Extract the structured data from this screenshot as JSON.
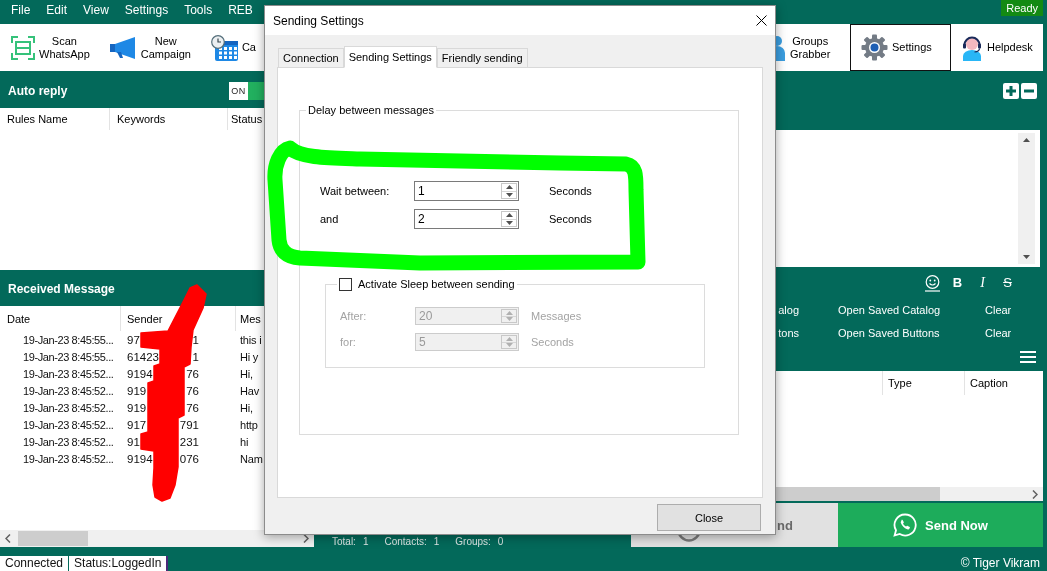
{
  "menu": {
    "items": [
      "File",
      "Edit",
      "View",
      "Settings",
      "Tools",
      "REB"
    ],
    "badge": "Ready"
  },
  "toolbar": {
    "left": [
      {
        "lines": [
          "Scan",
          "WhatsApp"
        ],
        "selected": false
      },
      {
        "lines": [
          "New",
          "Campaign"
        ],
        "selected": false
      },
      {
        "lines": [
          "Ca"
        ],
        "selected": false
      }
    ],
    "right": [
      {
        "lines": [
          "Groups",
          "Grabber"
        ],
        "selected": false
      },
      {
        "lines": [
          "Settings"
        ],
        "selected": true
      },
      {
        "lines": [
          "Helpdesk"
        ],
        "selected": false
      }
    ]
  },
  "auto_reply": {
    "title": "Auto reply",
    "toggle": {
      "label": "ON",
      "on": true
    },
    "columns": [
      "Rules Name",
      "Keywords",
      "Status"
    ]
  },
  "received": {
    "title": "Received Message",
    "columns": [
      "Date",
      "Sender",
      "Mes"
    ],
    "rows": [
      {
        "date": "19-Jan-23 8:45:55...",
        "sender_start": "97",
        "sender_end": "1",
        "message": "this i"
      },
      {
        "date": "19-Jan-23 8:45:55...",
        "sender_start": "61423",
        "sender_end": "1",
        "message": "Hi y"
      },
      {
        "date": "19-Jan-23 8:45:52...",
        "sender_start": "9194",
        "sender_end": "76",
        "message": "Hi,"
      },
      {
        "date": "19-Jan-23 8:45:52...",
        "sender_start": "919",
        "sender_end": "76",
        "message": "Hav"
      },
      {
        "date": "19-Jan-23 8:45:52...",
        "sender_start": "919",
        "sender_end": "76",
        "message": "Hi,"
      },
      {
        "date": "19-Jan-23 8:45:52...",
        "sender_start": "917",
        "sender_end": "791",
        "message": "http"
      },
      {
        "date": "19-Jan-23 8:45:52...",
        "sender_start": "91",
        "sender_end": "231",
        "message": "hi"
      },
      {
        "date": "19-Jan-23 8:45:52...",
        "sender_start": "9194",
        "sender_end": "076",
        "message": "Nam"
      }
    ]
  },
  "counts": [
    {
      "label": "Total:",
      "value": "1"
    },
    {
      "label": "Contacts:",
      "value": "1"
    },
    {
      "label": "Groups:",
      "value": "0"
    }
  ],
  "composer": {
    "format_buttons": [
      {
        "kind": "bold",
        "label": "B"
      },
      {
        "kind": "italic",
        "label": "I"
      },
      {
        "kind": "strikethrough",
        "label": "S"
      }
    ],
    "options": [
      {
        "label": "alog",
        "open": "Open Saved Catalog",
        "clear": "Clear"
      },
      {
        "label": "tons",
        "open": "Open Saved Buttons",
        "clear": "Clear"
      }
    ],
    "media_columns": [
      "Type",
      "Caption"
    ],
    "actions": [
      {
        "kind": "secondary",
        "label": "nd"
      },
      {
        "kind": "primary",
        "label": "Send Now"
      }
    ]
  },
  "status_bar": {
    "items": [
      "Connected",
      "Status:LoggedIn"
    ],
    "copyright": "© Tiger Vikram"
  },
  "dialog": {
    "title": "Sending Settings",
    "tabs": [
      {
        "label": "Connection",
        "selected": false
      },
      {
        "label": "Sending Settings",
        "selected": true
      },
      {
        "label": "Friendly sending",
        "selected": false
      }
    ],
    "delay_group": {
      "title": "Delay between messages",
      "rows": [
        {
          "label": "Wait between:",
          "value": "1",
          "unit": "Seconds"
        },
        {
          "label": "and",
          "value": "2",
          "unit": "Seconds"
        }
      ]
    },
    "sleep_group": {
      "label": "Activate Sleep between sending",
      "checked": false,
      "rows": [
        {
          "label": "After:",
          "value": "20",
          "unit": "Messages",
          "disabled": true
        },
        {
          "label": "for:",
          "value": "5",
          "unit": "Seconds",
          "disabled": true
        }
      ]
    },
    "close_button": "Close"
  }
}
